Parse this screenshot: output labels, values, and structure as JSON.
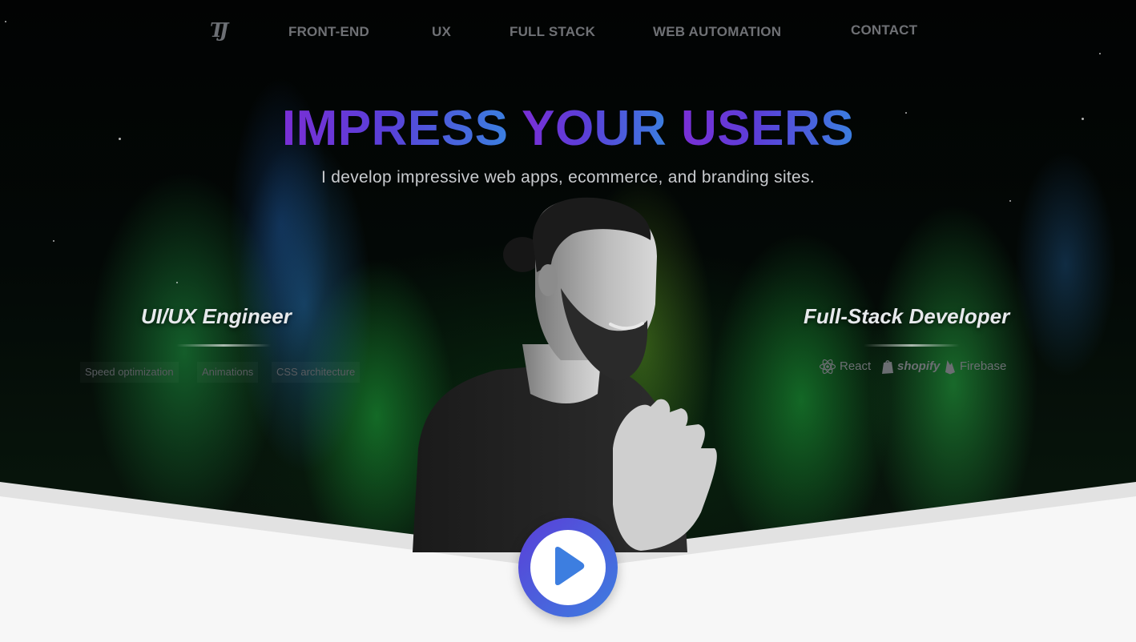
{
  "nav": {
    "logo": "TJ",
    "links": [
      "FRONT-END",
      "UX",
      "FULL STACK",
      "WEB AUTOMATION",
      "CONTACT"
    ]
  },
  "hero": {
    "headline_words": [
      "IMPRESS",
      "YOUR",
      "USERS"
    ],
    "subheadline": "I develop impressive web apps, ecommerce, and branding sites."
  },
  "left_column": {
    "title": "UI/UX Engineer",
    "skills": [
      "Speed optimization",
      "Animations",
      "CSS architecture"
    ]
  },
  "right_column": {
    "title": "Full-Stack Developer",
    "technologies": [
      {
        "name": "React",
        "icon": "react-icon"
      },
      {
        "name": "shopify",
        "icon": "shopify-icon"
      },
      {
        "name": "Firebase",
        "icon": "firebase-icon"
      }
    ]
  },
  "play_button": {
    "icon": "play-icon"
  },
  "colors": {
    "gradient_start": "#7a2fd6",
    "gradient_end": "#3b7fe0",
    "nav_text": "#6f7175",
    "bottom_bg": "#f7f7f7"
  }
}
